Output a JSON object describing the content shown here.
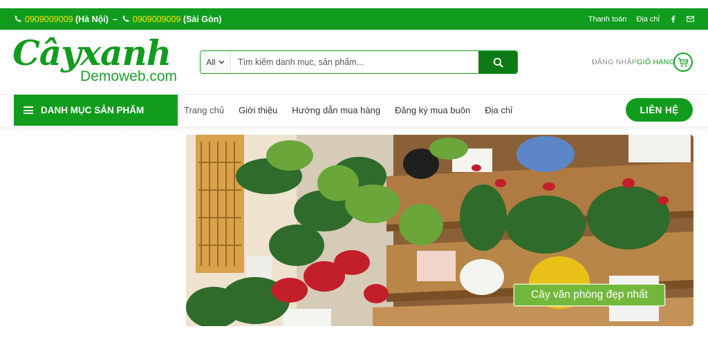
{
  "topbar": {
    "phone_hanoi": "0909009009",
    "city_hanoi": "(Hà Nội)",
    "separator": "–",
    "phone_saigon": "0909009009",
    "city_saigon": "(Sài Gòn)",
    "link_payment": "Thanh toán",
    "link_address": "Địa chỉ",
    "social_icons": [
      "facebook-icon",
      "mail-icon"
    ]
  },
  "logo": {
    "script_text": "Câyxanh",
    "sub_text": "Demoweb.com"
  },
  "search": {
    "category_value": "All",
    "placeholder": "Tìm kiếm danh mục, sản phẩm...",
    "button_icon": "search-icon"
  },
  "account": {
    "login_label": "ĐĂNG NHẬP",
    "cart_label": "GIỎ HÀNG",
    "cart_icon": "cart-icon"
  },
  "nav": {
    "category_label": "DANH MỤC SẢN PHẨM",
    "items": [
      "Trang chủ",
      "Giới thiệu",
      "Hướng dẫn mua hàng",
      "Đăng ký mua buôn",
      "Địa chỉ"
    ],
    "contact_label": "LIÊN HỆ"
  },
  "banner": {
    "caption": "Cây văn phòng đẹp nhất"
  },
  "colors": {
    "brand_green": "#119c1d",
    "dark_green": "#0e7a16",
    "phone_yellow": "#ffe500",
    "caption_green": "#74b73d"
  }
}
